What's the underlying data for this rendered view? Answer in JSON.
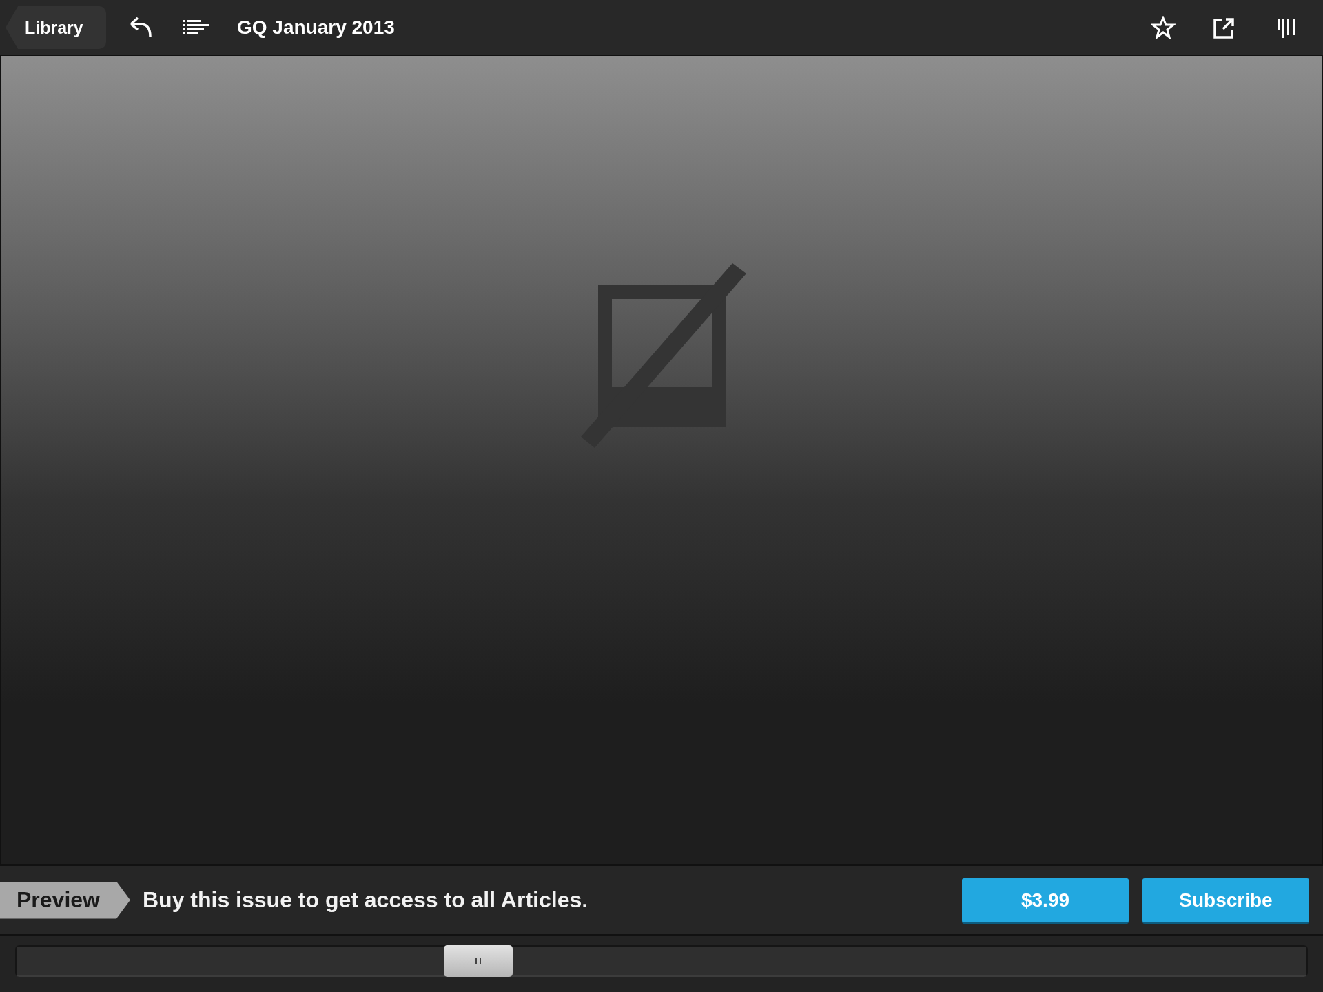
{
  "toolbar": {
    "back_label": "Library",
    "title": "GQ January 2013"
  },
  "banner": {
    "tag": "Preview",
    "message": "Buy this issue to get access to all Articles.",
    "buttons": [
      "$3.99",
      "Subscribe"
    ]
  },
  "page_slider": {
    "level": 0.35
  }
}
